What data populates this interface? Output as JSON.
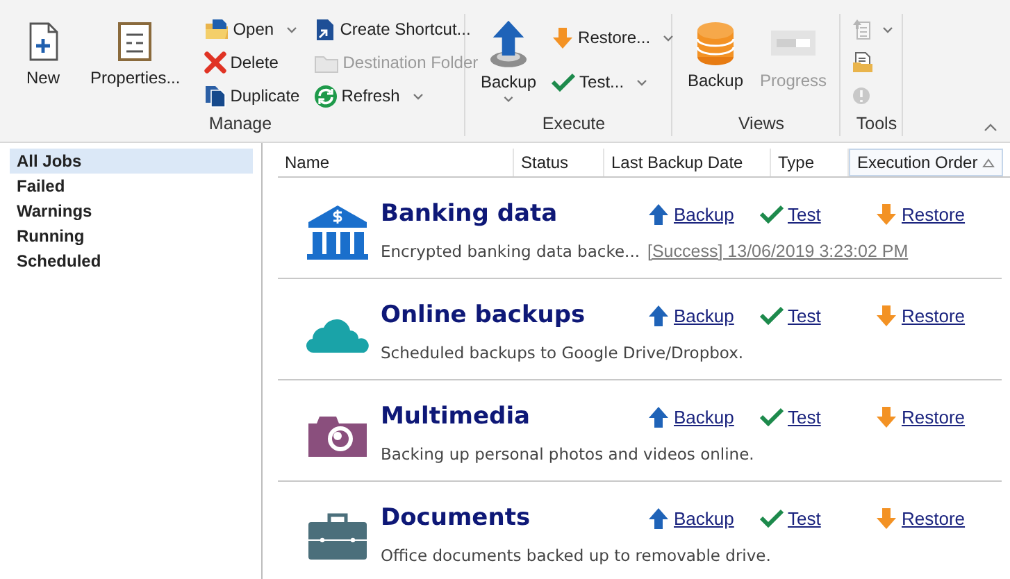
{
  "ribbon": {
    "groups": [
      {
        "label": "Manage",
        "items": [
          {
            "kind": "large",
            "label": "New",
            "dropdown": false,
            "disabled": false
          },
          {
            "kind": "large",
            "label": "Properties...",
            "dropdown": false,
            "disabled": false
          },
          {
            "kind": "small",
            "label": "Open",
            "dropdown": true,
            "disabled": false
          },
          {
            "kind": "small",
            "label": "Delete",
            "dropdown": false,
            "disabled": false
          },
          {
            "kind": "small",
            "label": "Duplicate",
            "dropdown": false,
            "disabled": false
          },
          {
            "kind": "small",
            "label": "Create Shortcut...",
            "dropdown": false,
            "disabled": false
          },
          {
            "kind": "small",
            "label": "Destination Folder",
            "dropdown": false,
            "disabled": true
          },
          {
            "kind": "small",
            "label": "Refresh",
            "dropdown": true,
            "disabled": false
          }
        ]
      },
      {
        "label": "Execute",
        "items": [
          {
            "kind": "large",
            "label": "Backup",
            "dropdown": true,
            "disabled": false
          },
          {
            "kind": "small",
            "label": "Restore...",
            "dropdown": true,
            "disabled": false
          },
          {
            "kind": "small",
            "label": "Test...",
            "dropdown": true,
            "disabled": false
          }
        ]
      },
      {
        "label": "Views",
        "items": [
          {
            "kind": "large",
            "label": "Backup",
            "dropdown": false,
            "disabled": false
          },
          {
            "kind": "large",
            "label": "Progress",
            "dropdown": false,
            "disabled": true
          }
        ]
      },
      {
        "label": "Tools",
        "items": [
          {
            "kind": "icon",
            "dropdown": true,
            "disabled": true
          },
          {
            "kind": "icon",
            "dropdown": false,
            "disabled": false
          },
          {
            "kind": "icon",
            "dropdown": false,
            "disabled": true
          }
        ]
      }
    ]
  },
  "sidebar": {
    "items": [
      {
        "label": "All Jobs",
        "selected": true
      },
      {
        "label": "Failed",
        "selected": false
      },
      {
        "label": "Warnings",
        "selected": false
      },
      {
        "label": "Running",
        "selected": false
      },
      {
        "label": "Scheduled",
        "selected": false
      }
    ]
  },
  "table": {
    "columns": [
      {
        "label": "Name",
        "sorted": false
      },
      {
        "label": "Status",
        "sorted": false
      },
      {
        "label": "Last Backup Date",
        "sorted": false
      },
      {
        "label": "Type",
        "sorted": false
      },
      {
        "label": "Execution Order",
        "sorted": true
      }
    ],
    "jobs": [
      {
        "title": "Banking data",
        "description": "Encrypted banking data backe...",
        "status": "[Success] 13/06/2019 3:23:02 PM",
        "actions": [
          "Backup",
          "Test",
          "Restore"
        ]
      },
      {
        "title": "Online backups",
        "description": "Scheduled backups to Google Drive/Dropbox.",
        "actions": [
          "Backup",
          "Test",
          "Restore"
        ]
      },
      {
        "title": "Multimedia",
        "description": "Backing up personal photos and videos online.",
        "actions": [
          "Backup",
          "Test",
          "Restore"
        ]
      },
      {
        "title": "Documents",
        "description": "Office documents backed up to removable drive.",
        "actions": [
          "Backup",
          "Test",
          "Restore"
        ]
      }
    ]
  }
}
